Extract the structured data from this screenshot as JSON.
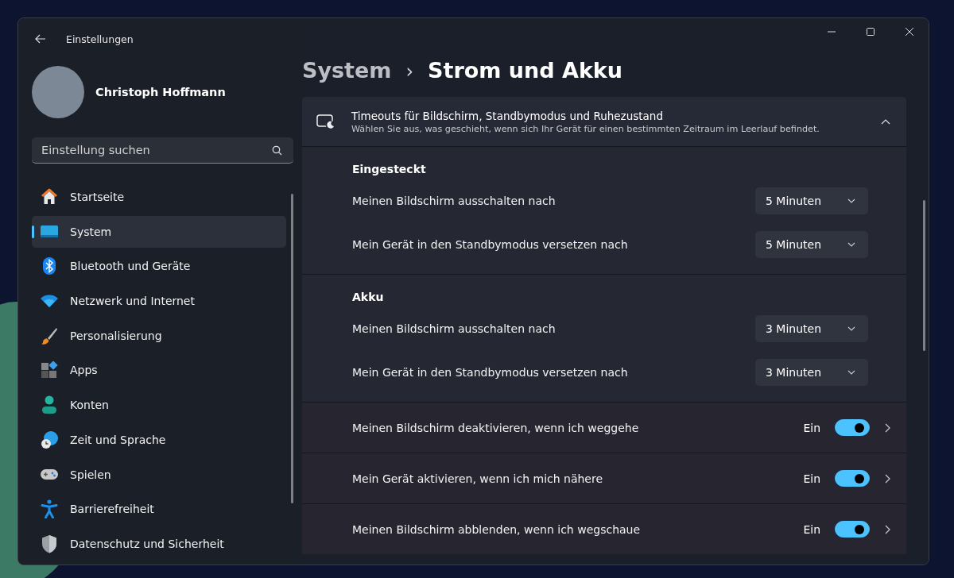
{
  "window": {
    "title": "Einstellungen"
  },
  "profile": {
    "name": "Christoph Hoffmann"
  },
  "search": {
    "placeholder": "Einstellung suchen"
  },
  "sidebar": {
    "items": [
      {
        "label": "Startseite",
        "selected": false
      },
      {
        "label": "System",
        "selected": true
      },
      {
        "label": "Bluetooth und Geräte",
        "selected": false
      },
      {
        "label": "Netzwerk und Internet",
        "selected": false
      },
      {
        "label": "Personalisierung",
        "selected": false
      },
      {
        "label": "Apps",
        "selected": false
      },
      {
        "label": "Konten",
        "selected": false
      },
      {
        "label": "Zeit und Sprache",
        "selected": false
      },
      {
        "label": "Spielen",
        "selected": false
      },
      {
        "label": "Barrierefreiheit",
        "selected": false
      },
      {
        "label": "Datenschutz und Sicherheit",
        "selected": false
      }
    ]
  },
  "breadcrumb": {
    "parent": "System",
    "separator": "›",
    "current": "Strom und Akku"
  },
  "expander": {
    "title": "Timeouts für Bildschirm, Standbymodus und Ruhezustand",
    "description": "Wählen Sie aus, was geschieht, wenn sich Ihr Gerät für einen bestimmten Zeitraum im Leerlauf befindet.",
    "expanded": true,
    "groups": [
      {
        "heading": "Eingesteckt",
        "rows": [
          {
            "label": "Meinen Bildschirm ausschalten nach",
            "value": "5 Minuten"
          },
          {
            "label": "Mein Gerät in den Standbymodus versetzen nach",
            "value": "5 Minuten"
          }
        ]
      },
      {
        "heading": "Akku",
        "rows": [
          {
            "label": "Meinen Bildschirm ausschalten nach",
            "value": "3 Minuten"
          },
          {
            "label": "Mein Gerät in den Standbymodus versetzen nach",
            "value": "3 Minuten"
          }
        ]
      }
    ]
  },
  "toggle_rows": [
    {
      "label": "Meinen Bildschirm deaktivieren, wenn ich weggehe",
      "state": "Ein",
      "on": true
    },
    {
      "label": "Mein Gerät aktivieren, wenn ich mich nähere",
      "state": "Ein",
      "on": true
    },
    {
      "label": "Meinen Bildschirm abblenden, wenn ich wegschaue",
      "state": "Ein",
      "on": true
    }
  ]
}
